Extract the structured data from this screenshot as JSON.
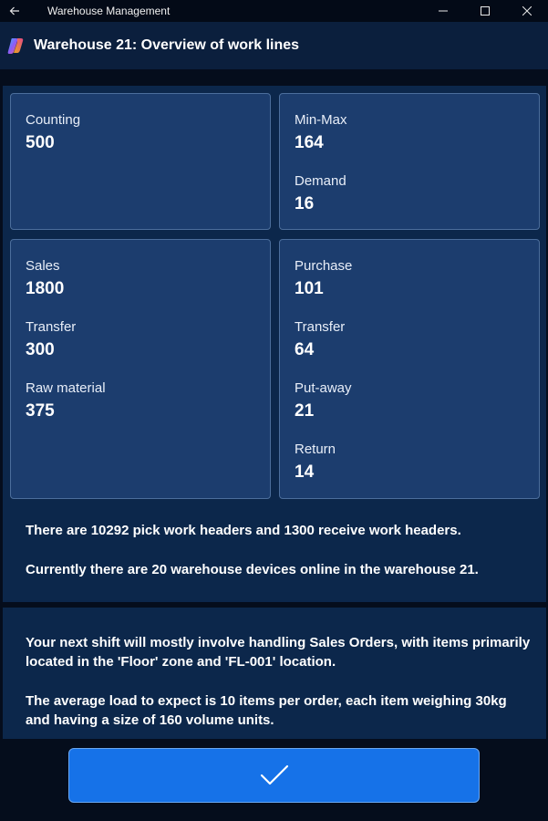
{
  "window": {
    "title": "Warehouse Management",
    "icons": {
      "back": "back-arrow-icon",
      "minimize": "minimize-icon",
      "maximize": "maximize-icon",
      "close": "close-icon"
    }
  },
  "header": {
    "title": "Warehouse 21: Overview of work lines",
    "logo": "copilot-logo-icon"
  },
  "cards": {
    "counting": {
      "label": "Counting",
      "value": "500"
    },
    "minmax": {
      "label": "Min-Max",
      "value": "164"
    },
    "demand": {
      "label": "Demand",
      "value": "16"
    },
    "sales": {
      "label": "Sales",
      "value": "1800"
    },
    "transfer_left": {
      "label": "Transfer",
      "value": "300"
    },
    "raw_material": {
      "label": "Raw material",
      "value": "375"
    },
    "purchase": {
      "label": "Purchase",
      "value": "101"
    },
    "transfer_right": {
      "label": "Transfer",
      "value": "64"
    },
    "putaway": {
      "label": "Put-away",
      "value": "21"
    },
    "return": {
      "label": "Return",
      "value": "14"
    }
  },
  "summary": {
    "headers": "There are 10292 pick work headers and 1300 receive work headers.",
    "devices": "Currently there are 20 warehouse devices online in the warehouse 21."
  },
  "shift": {
    "paragraph1": "Your next shift will mostly involve handling Sales Orders, with items primarily located in the 'Floor' zone and 'FL-001' location.",
    "paragraph2": "The average load to expect is 10 items per order, each item weighing 30kg and having a size of 160 volume units."
  },
  "confirm": {
    "icon": "checkmark-icon"
  },
  "colors": {
    "accent": "#1672e8",
    "card": "#1c3d6e",
    "panel": "#0c274b",
    "background": "#050d1c"
  }
}
